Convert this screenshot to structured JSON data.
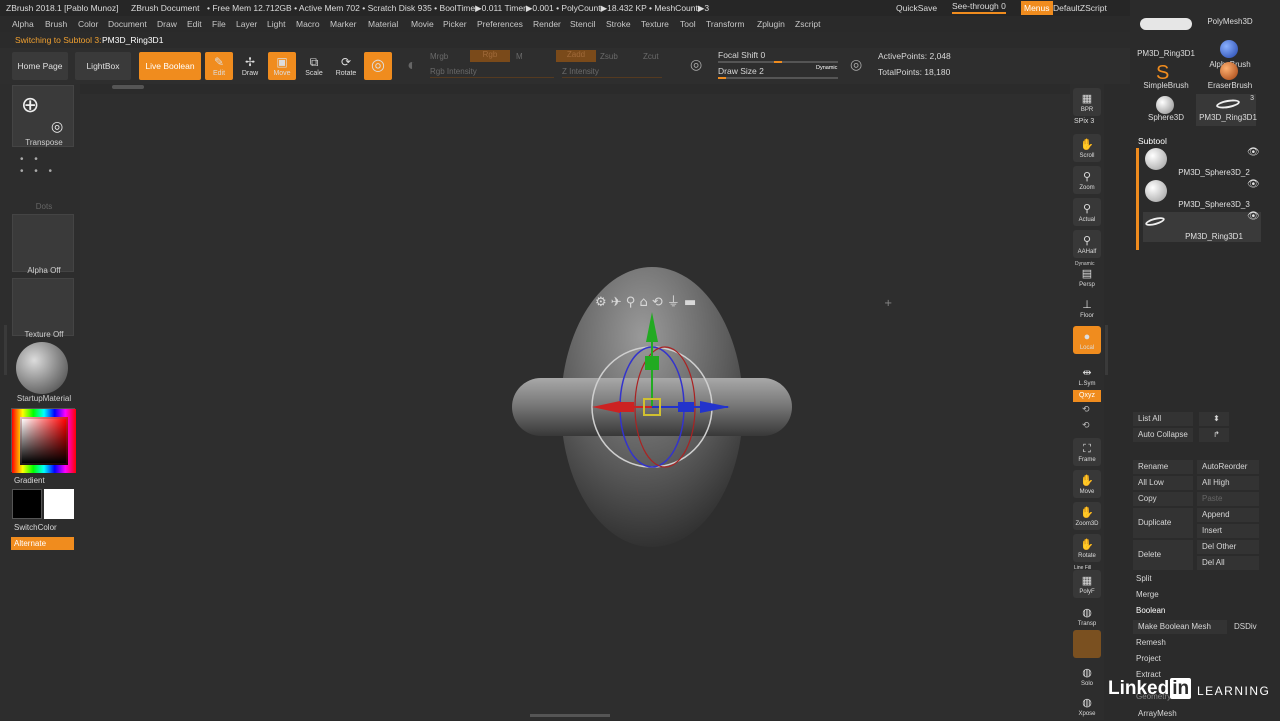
{
  "titlebar": {
    "app": "ZBrush 2018.1 [Pablo Munoz]",
    "doc": "ZBrush Document",
    "stats": "• Free Mem 12.712GB • Active Mem 702 • Scratch Disk 935 • BoolTime▶0.011 Timer▶0.001 • PolyCount▶18.432 KP • MeshCount▶3",
    "quicksave": "QuickSave",
    "seethrough": "See-through  0",
    "menus": "Menus",
    "script": "DefaultZScript"
  },
  "menus": [
    "Alpha",
    "Brush",
    "Color",
    "Document",
    "Draw",
    "Edit",
    "File",
    "Layer",
    "Light",
    "Macro",
    "Marker",
    "Material",
    "Movie",
    "Picker",
    "Preferences",
    "Render",
    "Stencil",
    "Stroke",
    "Texture",
    "Tool",
    "Transform",
    "Zplugin",
    "Zscript"
  ],
  "status": {
    "label": "Switching to Subtool 3:",
    "name": "PM3D_Ring3D1"
  },
  "toolbar": {
    "home": "Home Page",
    "lightbox": "LightBox",
    "liveboolean": "Live Boolean",
    "edit": "Edit",
    "draw": "Draw",
    "move": "Move",
    "scale": "Scale",
    "rotate": "Rotate",
    "mrgb": "Mrgb",
    "rgb": "Rgb",
    "m": "M",
    "zadd": "Zadd",
    "zsub": "Zsub",
    "zcut": "Zcut",
    "rgbintensity": "Rgb Intensity",
    "zintensity": "Z Intensity",
    "focalshift": "Focal Shift 0",
    "drawsize": "Draw Size 2",
    "dynamic": "Dynamic",
    "activepoints": "ActivePoints: 2,048",
    "totalpoints": "TotalPoints: 18,180"
  },
  "left": {
    "transpose": "Transpose",
    "dots": "Dots",
    "alpha": "Alpha Off",
    "texture": "Texture Off",
    "material": "StartupMaterial",
    "gradient": "Gradient",
    "switchcolor": "SwitchColor",
    "alternate": "Alternate"
  },
  "right_shelf": [
    {
      "name": "bpr",
      "label": "BPR"
    },
    {
      "name": "spix",
      "label": "SPix 3"
    },
    {
      "name": "scroll",
      "label": "Scroll"
    },
    {
      "name": "zoom",
      "label": "Zoom"
    },
    {
      "name": "actual",
      "label": "Actual"
    },
    {
      "name": "aahalf",
      "label": "AAHalf"
    },
    {
      "name": "persp",
      "label": "Persp"
    },
    {
      "name": "floor",
      "label": "Floor"
    },
    {
      "name": "local",
      "label": "Local"
    },
    {
      "name": "lsym",
      "label": "L.Sym"
    },
    {
      "name": "xyz",
      "label": "Qxyz"
    },
    {
      "name": "frame",
      "label": "Frame"
    },
    {
      "name": "move",
      "label": "Move"
    },
    {
      "name": "zoom3d",
      "label": "Zoom3D"
    },
    {
      "name": "rotate",
      "label": "Rotate"
    },
    {
      "name": "polyf",
      "label": "PolyF"
    },
    {
      "name": "transp",
      "label": "Transp"
    },
    {
      "name": "solo",
      "label": "Solo"
    },
    {
      "name": "xpose",
      "label": "Xpose"
    }
  ],
  "right_shelf_extra": {
    "dynamic": "Dynamic",
    "linefill": "Line Fill"
  },
  "tools": {
    "t1": "PM3D_Ring3D1",
    "t2": "PolyMesh3D",
    "t3": "AlphaBrush",
    "t4": "SimpleBrush",
    "t5": "EraserBrush",
    "t6": "Sphere3D",
    "t7": "PM3D_Ring3D1",
    "count": "3"
  },
  "subtool": {
    "title": "Subtool",
    "items": [
      "PM3D_Sphere3D_2",
      "PM3D_Sphere3D_3",
      "PM3D_Ring3D1"
    ]
  },
  "sidebar": {
    "listall": "List All",
    "autocollapse": "Auto Collapse",
    "rename": "Rename",
    "autoreorder": "AutoReorder",
    "alllow": "All Low",
    "allhigh": "All High",
    "copy": "Copy",
    "paste": "Paste",
    "duplicate": "Duplicate",
    "append": "Append",
    "insert": "Insert",
    "delete": "Delete",
    "delother": "Del Other",
    "delall": "Del All",
    "split": "Split",
    "merge": "Merge",
    "boolean": "Boolean",
    "makeboolean": "Make Boolean Mesh",
    "dsdiv": "DSDiv",
    "remesh": "Remesh",
    "project": "Project",
    "extract": "Extract",
    "geometry": "Geometry",
    "arraymesh": "ArrayMesh"
  },
  "watermark": {
    "brand": "Linked",
    "in": "in",
    "learning": "LEARNING"
  }
}
